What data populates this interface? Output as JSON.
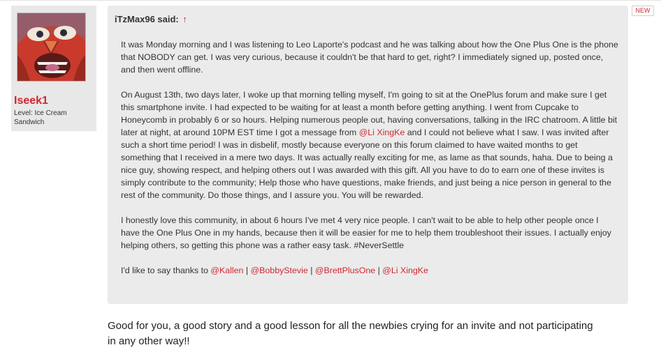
{
  "user": {
    "name": "Iseek1",
    "level": "Level: Ice Cream Sandwich",
    "avatar_icon": "screaming-face-avatar"
  },
  "badge": {
    "new_label": "NEW"
  },
  "quote": {
    "author_said": "iTzMax96 said:",
    "jump_arrow": "↑",
    "paragraphs": {
      "p1": "It was Monday morning and I was listening to Leo Laporte's podcast and he was talking about how the One Plus One is the phone that NOBODY can get. I was very curious, because it couldn't be that hard to get, right? I immediately signed up, posted once, and then went offline.",
      "p2a": "On August 13th, two days later, I woke up that morning telling myself, I'm going to sit at the OnePlus forum and make sure I get this smartphone invite. I had expected to be waiting for at least a month before getting anything. I went from Cupcake to Honeycomb in probably 6 or so hours. Helping numerous people out, having conversations, talking in the IRC chatroom. A little bit later at night, at around 10PM EST time I got a message from",
      "p2_mention": "@Li XingKe",
      "p2b": "and I could not believe what I saw. I was invited after such a short time period! I was in disbelif, mostly because everyone on this forum claimed to have waited months to get something that I received in a mere two days. It was actually really exciting for me, as lame as that sounds, haha. Due to being a nice guy, showing respect, and helping others out I was awarded with this gift. All you have to do to earn one of these invites is simply contribute to the community; Help those who have questions, make friends, and just being a nice person in general to the rest of the community. Do those things, and I assure you. You will be rewarded.",
      "p3": "I honestly love this community, in about 6 hours I've met 4 very nice people. I can't wait to be able to help other people once I have the One Plus One in my hands, because then it will be easier for me to help them troubleshoot their issues. I actually enjoy helping others, so getting this phone was a rather easy task. #NeverSettle",
      "p4_intro": "I'd like to say thanks to",
      "mentions": [
        "@Kallen",
        "@BobbyStevie",
        "@BrettPlusOne",
        "@Li XingKe"
      ],
      "separator": "|"
    }
  },
  "reply": {
    "text": "Good for you, a good story and a good lesson for all the newbies crying for an invite and not participating in any other way!!"
  }
}
